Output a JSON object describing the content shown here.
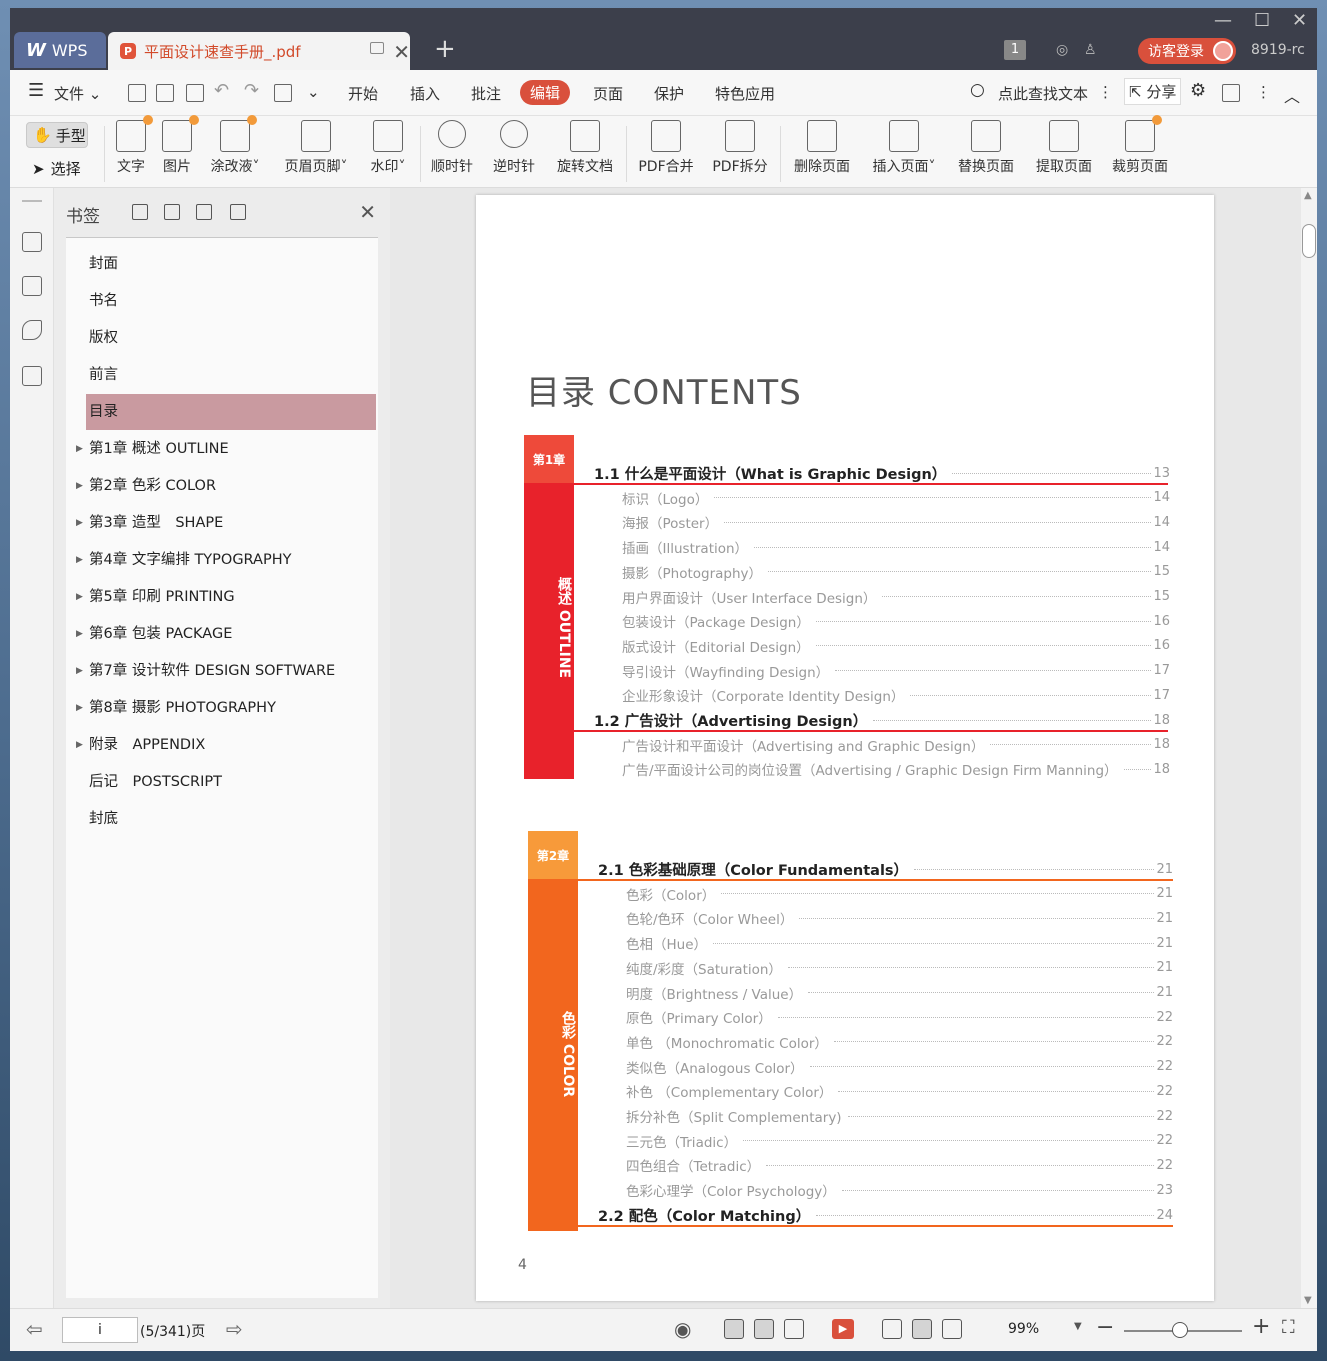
{
  "titlebar": {
    "app_tab": "WPS",
    "doc_tab": "平面设计速查手册_.pdf",
    "badge": "1",
    "login": "访客登录",
    "user_id": "8919-rc"
  },
  "menu": {
    "file": "文件",
    "tabs": [
      "开始",
      "插入",
      "批注",
      "编辑",
      "页面",
      "保护",
      "特色应用"
    ],
    "active_tab": "编辑",
    "search": "点此查找文本",
    "share": "分享"
  },
  "ribbon": {
    "hand": "手型",
    "select": "选择",
    "buttons": [
      "文字",
      "图片",
      "涂改液",
      "页眉页脚",
      "水印",
      "顺时针",
      "逆时针",
      "旋转文档",
      "PDF合并",
      "PDF拆分",
      "删除页面",
      "插入页面",
      "替换页面",
      "提取页面",
      "裁剪页面"
    ]
  },
  "bookmarks": {
    "title": "书签",
    "items": [
      "封面",
      "书名",
      "版权",
      "前言",
      "目录",
      "第1章 概述 OUTLINE",
      "第2章 色彩 COLOR",
      "第3章 造型　SHAPE",
      "第4章 文字编排 TYPOGRAPHY",
      "第5章 印刷 PRINTING",
      "第6章 包装 PACKAGE",
      "第7章 设计软件 DESIGN SOFTWARE",
      "第8章 摄影 PHOTOGRAPHY",
      "附录　APPENDIX",
      "后记　POSTSCRIPT",
      "封底"
    ],
    "selected": "目录"
  },
  "page": {
    "title": "目录 CONTENTS",
    "number": "4",
    "chapters": [
      {
        "label": "第1章",
        "vertical": "概述 OUTLINE",
        "color": "#e8222b",
        "entries": [
          {
            "text": "1.1  什么是平面设计（What is Graphic Design）",
            "page": "13",
            "main": true
          },
          {
            "text": "标识（Logo）",
            "page": "14"
          },
          {
            "text": "海报（Poster）",
            "page": "14"
          },
          {
            "text": "插画（Illustration）",
            "page": "14"
          },
          {
            "text": "摄影（Photography）",
            "page": "15"
          },
          {
            "text": "用户界面设计（User Interface Design）",
            "page": "15"
          },
          {
            "text": "包装设计（Package Design）",
            "page": "16"
          },
          {
            "text": "版式设计（Editorial Design）",
            "page": "16"
          },
          {
            "text": "导引设计（Wayfinding Design）",
            "page": "17"
          },
          {
            "text": "企业形象设计（Corporate Identity Design）",
            "page": "17"
          },
          {
            "text": "1.2  广告设计（Advertising Design）",
            "page": "18",
            "main": true
          },
          {
            "text": "广告设计和平面设计（Advertising and Graphic Design）",
            "page": "18"
          },
          {
            "text": "广告/平面设计公司的岗位设置（Advertising / Graphic Design Firm Manning）",
            "page": "18"
          }
        ]
      },
      {
        "label": "第2章",
        "vertical": "色彩 COLOR",
        "color": "#f2661e",
        "entries": [
          {
            "text": "2.1  色彩基础原理（Color Fundamentals）",
            "page": "21",
            "main": true
          },
          {
            "text": "色彩（Color）",
            "page": "21"
          },
          {
            "text": "色轮/色环（Color Wheel）",
            "page": "21"
          },
          {
            "text": "色相（Hue）",
            "page": "21"
          },
          {
            "text": "纯度/彩度（Saturation）",
            "page": "21"
          },
          {
            "text": "明度（Brightness / Value）",
            "page": "21"
          },
          {
            "text": "原色（Primary Color）",
            "page": "22"
          },
          {
            "text": "单色 （Monochromatic Color）",
            "page": "22"
          },
          {
            "text": "类似色（Analogous Color）",
            "page": "22"
          },
          {
            "text": "补色 （Complementary Color）",
            "page": "22"
          },
          {
            "text": "拆分补色（Split Complementary)",
            "page": "22"
          },
          {
            "text": "三元色（Triadic）",
            "page": "22"
          },
          {
            "text": "四色组合（Tetradic）",
            "page": "22"
          },
          {
            "text": "色彩心理学（Color Psychology）",
            "page": "23"
          },
          {
            "text": "2.2  配色（Color Matching）",
            "page": "24",
            "main": true
          }
        ]
      }
    ]
  },
  "status": {
    "page_input": "i",
    "page_info": "(5/341)页",
    "zoom": "99%"
  }
}
